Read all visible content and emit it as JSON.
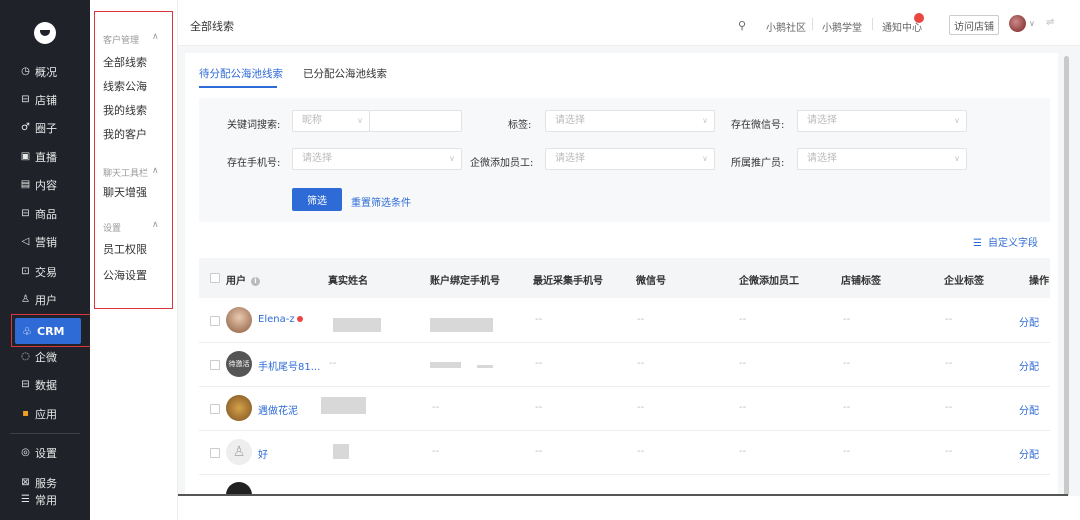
{
  "nav": {
    "items": [
      {
        "icon": "◷",
        "label": "概况"
      },
      {
        "icon": "⊟",
        "label": "店铺"
      },
      {
        "icon": "♂",
        "label": "圈子"
      },
      {
        "icon": "▣",
        "label": "直播"
      },
      {
        "icon": "▤",
        "label": "内容"
      },
      {
        "icon": "⊟",
        "label": "商品"
      },
      {
        "icon": "◁",
        "label": "营销"
      },
      {
        "icon": "⊡",
        "label": "交易"
      },
      {
        "icon": "♙",
        "label": "用户"
      },
      {
        "icon": "◌",
        "label": "企微"
      },
      {
        "icon": "⊟",
        "label": "数据"
      },
      {
        "icon": "▪",
        "label": "应用"
      },
      {
        "icon": "◎",
        "label": "设置"
      },
      {
        "icon": "⊠",
        "label": "服务"
      },
      {
        "icon": "☰",
        "label": "常用"
      }
    ],
    "crm_label": "CRM"
  },
  "submenu": {
    "groups": [
      {
        "title": "客户管理",
        "items": [
          "全部线索",
          "线索公海",
          "我的线索",
          "我的客户"
        ]
      },
      {
        "title": "聊天工具栏",
        "items": [
          "聊天增强"
        ]
      },
      {
        "title": "设置",
        "items": [
          "员工权限",
          "公海设置"
        ]
      }
    ]
  },
  "topbar": {
    "title": "全部线索",
    "links": [
      "小鹅社区",
      "小鹅学堂",
      "通知中心"
    ],
    "visit_store": "访问店铺"
  },
  "tabs": [
    "待分配公海池线索",
    "已分配公海池线索"
  ],
  "filters": {
    "keyword_label": "关键词搜索:",
    "keyword_type": "昵称",
    "tag_label": "标签:",
    "wechat_label": "存在微信号:",
    "phone_label": "存在手机号:",
    "staff_label": "企微添加员工:",
    "promoter_label": "所属推广员:",
    "placeholder": "请选择",
    "filter_button": "筛选",
    "reset_link": "重置筛选条件"
  },
  "custom_field": "自定义字段",
  "table": {
    "headers": [
      "用户",
      "真实姓名",
      "账户绑定手机号",
      "最近采集手机号",
      "微信号",
      "企微添加员工",
      "店铺标签",
      "企业标签",
      "操作"
    ],
    "rows": [
      {
        "name": "Elena-z",
        "dash": "--",
        "action": "分配"
      },
      {
        "name": "手机尾号81...",
        "real": "--",
        "dash": "--",
        "badge": "待激活",
        "action": "分配"
      },
      {
        "name": "遇做花泥",
        "dash": "--",
        "action": "分配"
      },
      {
        "name": "好",
        "dash": "--",
        "action": "分配"
      }
    ]
  }
}
